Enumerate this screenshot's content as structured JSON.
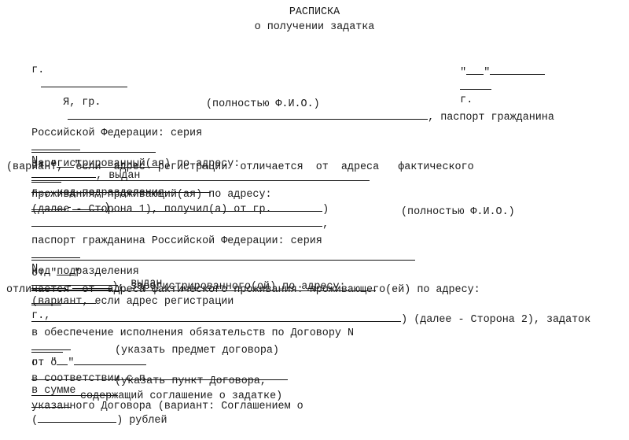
{
  "document": {
    "title": "РАСПИСКА",
    "subtitle": "о получении задатка",
    "city_label": "г.",
    "year_suffix": "г.",
    "lines": {
      "l1a": "Я, гр.",
      "l1b": ", паспорт гражданина",
      "l2": "(полностью Ф.И.О.)",
      "l3a": "Российской Федерации: серия",
      "l3b": "N",
      "l3c": ", выдан",
      "l4a": "от \"",
      "l4b": "\"",
      "l4c": "г., код подразделения",
      "l4d": "-",
      "l4e": "),",
      "l5": "зарегистрированный(ая) по адресу:",
      "l6": "(вариант,  если  адрес  регистрации  отличается  от  адреса   фактического",
      "l7a": "проживания: проживающий(ая) по адресу:",
      "l7b": ")",
      "l8a": "(далее - Сторона 1), получил(а) от гр.",
      "l8b": ",",
      "l9": "(полностью Ф.И.О.)",
      "l10a": "паспорт гражданина Российской Федерации: серия",
      "l10b": "N",
      "l10c": ", выдан",
      "l11a": "от \"",
      "l11b": "\"",
      "l11c": "г.,",
      "l12a": "код подразделения",
      "l12b": "-",
      "l12c": "), зарегистрированного(ой) по адресу:",
      "l13": "(вариант, если адрес регистрации",
      "l14": "отличается  от  адреса фактического проживания: проживающего(ей) по адресу:",
      "l15": ") (далее - Сторона 2), задаток",
      "l16a": "в обеспечение исполнения обязательств по Договору N",
      "l16b": "от \"",
      "l16c": "\"",
      "l17a": "г. о",
      "l17b": "в сумме",
      "l17c": "(",
      "l17d": ") рублей",
      "l18": "(указать предмет договора)",
      "l19a": "в соответствии с п.",
      "l19b": "указанного Договора (вариант: Соглашением о",
      "l20": "(указать пункт Договора,",
      "l21": "содержащий соглашение о задатке)"
    }
  }
}
